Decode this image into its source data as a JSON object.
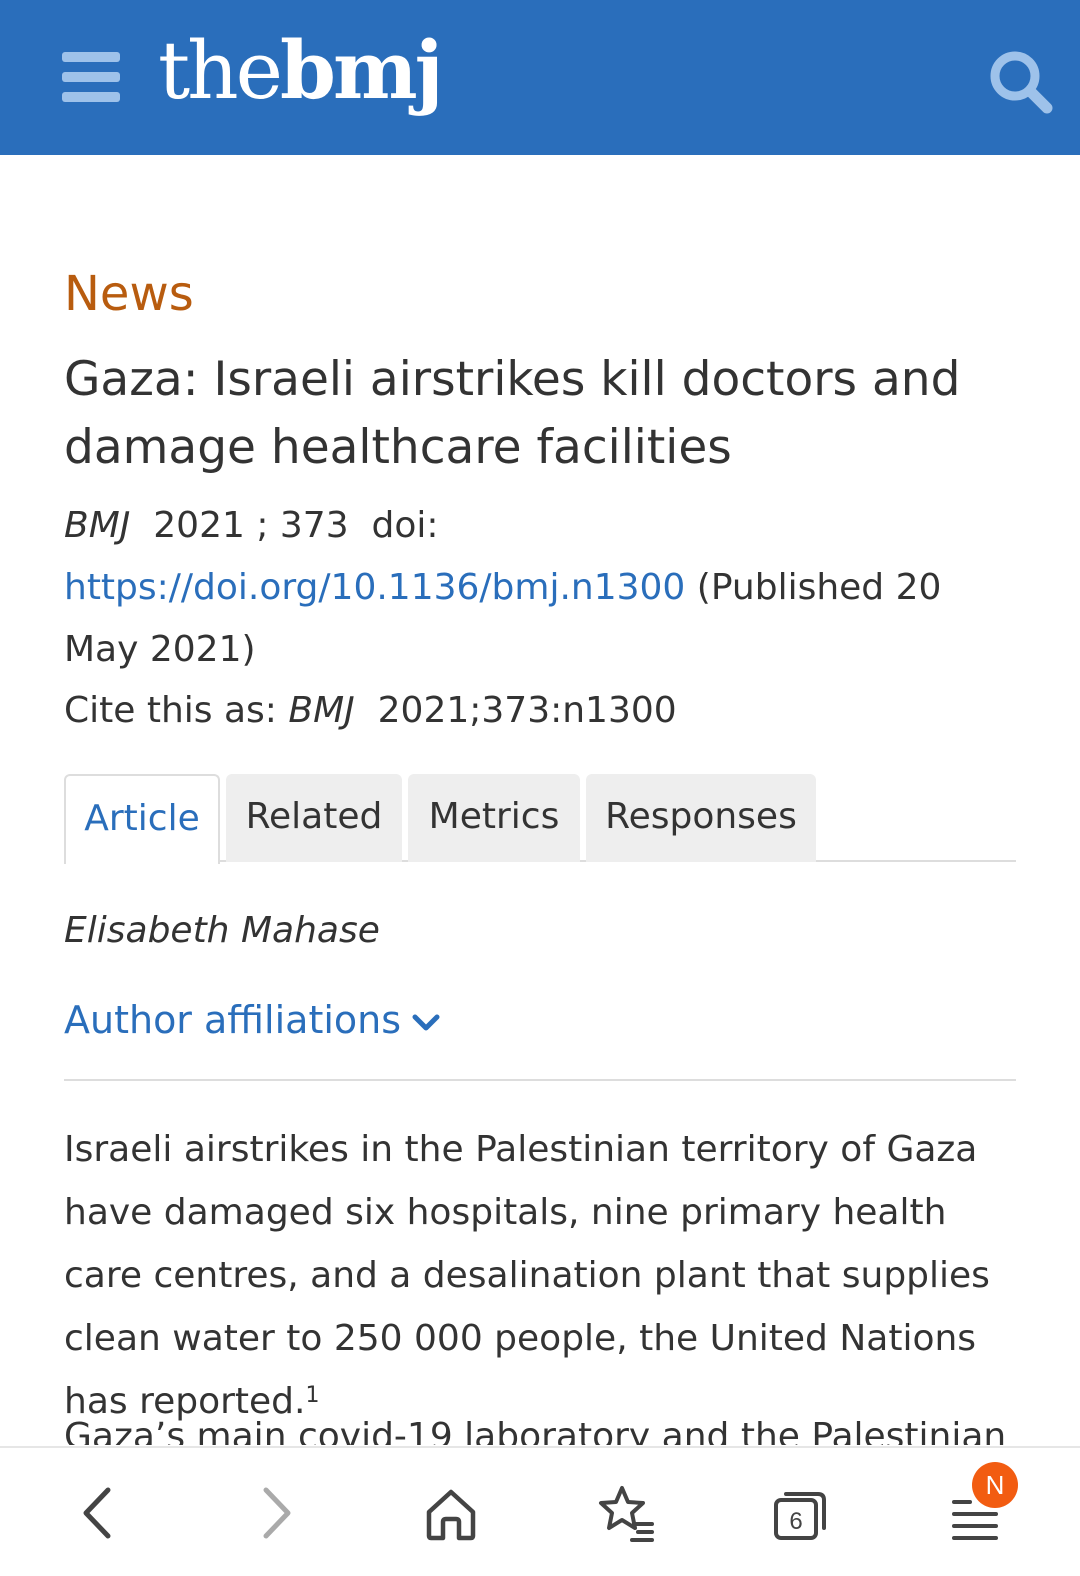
{
  "header": {
    "logo_prefix": "the",
    "logo_suffix": "bmj",
    "brand_color": "#2a6ebb",
    "menu_icon": "hamburger-icon",
    "search_icon": "search-icon"
  },
  "article": {
    "section": "News",
    "title": "Gaza: Israeli airstrikes kill doctors and damage healthcare facilities",
    "journal": "BMJ",
    "year_volume": "2021 ; 373",
    "doi_label": "doi:",
    "doi_url": "https://doi.org/10.1136/bmj.n1300",
    "published": "(Published 20 May 2021)",
    "cite_label": "Cite this as:",
    "cite_journal": "BMJ",
    "cite_ref": "2021;373:n1300"
  },
  "tabs": [
    {
      "label": "Article",
      "active": true
    },
    {
      "label": "Related",
      "active": false
    },
    {
      "label": "Metrics",
      "active": false
    },
    {
      "label": "Responses",
      "active": false
    }
  ],
  "author": "Elisabeth Mahase",
  "affiliations_label": "Author affiliations",
  "body": {
    "paragraph1": "Israeli airstrikes in the Palestinian territory of Gaza have damaged six hospitals, nine primary health care centres, and a desalination plant that supplies clean water to 250 000 people, the United Nations has reported.",
    "paragraph1_ref": "1",
    "paragraph2_start": "Gaza’s main covid-19 laboratory and the Palestinian"
  },
  "bottom_bar": {
    "back_icon": "back-arrow-icon",
    "forward_icon": "forward-arrow-icon",
    "home_icon": "home-icon",
    "bookmarks_icon": "bookmarks-icon",
    "tabs_count": "6",
    "menu_icon": "menu-icon",
    "notification_badge": "N",
    "badge_color": "#f25c11"
  }
}
